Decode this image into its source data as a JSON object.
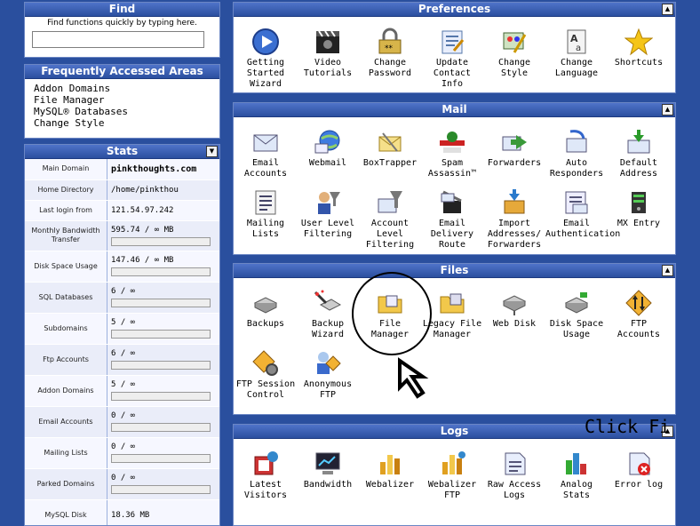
{
  "find": {
    "title": "Find",
    "hint": "Find functions quickly by typing here.",
    "value": ""
  },
  "freq": {
    "title": "Frequently Accessed Areas",
    "items": [
      "Addon Domains",
      "File Manager",
      "MySQL® Databases",
      "Change Style"
    ]
  },
  "stats": {
    "title": "Stats",
    "rows": [
      {
        "label": "Main Domain",
        "value": "pinkthoughts.com"
      },
      {
        "label": "Home Directory",
        "value": "/home/pinkthou"
      },
      {
        "label": "Last login from",
        "value": "121.54.97.242"
      },
      {
        "label": "Monthly Bandwidth Transfer",
        "value": "595.74 / ∞ MB"
      },
      {
        "label": "Disk Space Usage",
        "value": "147.46 / ∞ MB"
      },
      {
        "label": "SQL Databases",
        "value": "6 / ∞"
      },
      {
        "label": "Subdomains",
        "value": "5 / ∞"
      },
      {
        "label": "Ftp Accounts",
        "value": "6 / ∞"
      },
      {
        "label": "Addon Domains",
        "value": "5 / ∞"
      },
      {
        "label": "Email Accounts",
        "value": "0 / ∞"
      },
      {
        "label": "Mailing Lists",
        "value": "0 / ∞"
      },
      {
        "label": "Parked Domains",
        "value": "0 / ∞"
      },
      {
        "label": "MySQL Disk",
        "value": "18.36 MB"
      }
    ]
  },
  "preferences": {
    "title": "Preferences",
    "items": [
      "Getting Started Wizard",
      "Video Tutorials",
      "Change Password",
      "Update Contact Info",
      "Change Style",
      "Change Language",
      "Shortcuts"
    ]
  },
  "mail": {
    "title": "Mail",
    "items": [
      "Email Accounts",
      "Webmail",
      "BoxTrapper",
      "Spam Assassin™",
      "Forwarders",
      "Auto Responders",
      "Default Address",
      "Mailing Lists",
      "User Level Filtering",
      "Account Level Filtering",
      "Email Delivery Route",
      "Import Addresses/ Forwarders",
      "Email Authentication",
      "MX Entry"
    ]
  },
  "files": {
    "title": "Files",
    "items": [
      "Backups",
      "Backup Wizard",
      "File Manager",
      "Legacy File Manager",
      "Web Disk",
      "Disk Space Usage",
      "FTP Accounts",
      "FTP Session Control",
      "Anonymous FTP"
    ]
  },
  "logs": {
    "title": "Logs",
    "items": [
      "Latest Visitors",
      "Bandwidth",
      "Webalizer",
      "Webalizer FTP",
      "Raw Access Logs",
      "Analog Stats",
      "Error log"
    ]
  },
  "overlay": {
    "click_text": "Click Fi"
  },
  "colors": {
    "title_bar": "#2b4f9f",
    "background": "#2a4f9e",
    "panel_border": "#6b86c4"
  }
}
